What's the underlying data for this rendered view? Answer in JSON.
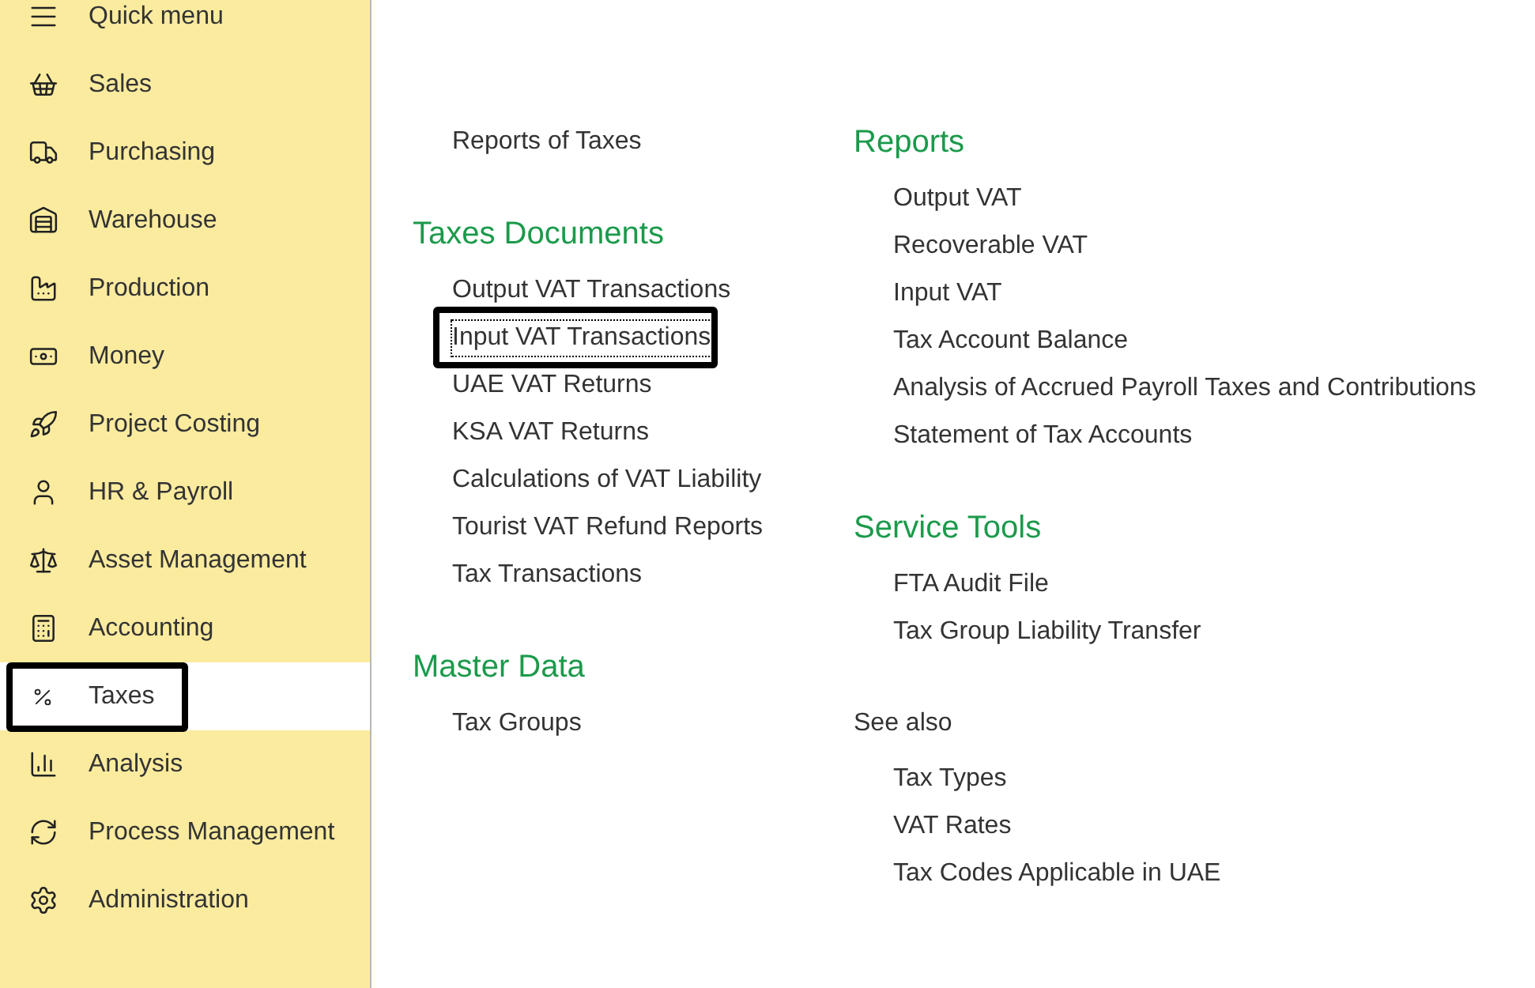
{
  "sidebar": {
    "items": [
      {
        "label": "Quick menu",
        "selected": false,
        "highlighted": false
      },
      {
        "label": "Sales",
        "selected": false,
        "highlighted": false
      },
      {
        "label": "Purchasing",
        "selected": false,
        "highlighted": false
      },
      {
        "label": "Warehouse",
        "selected": false,
        "highlighted": false
      },
      {
        "label": "Production",
        "selected": false,
        "highlighted": false
      },
      {
        "label": "Money",
        "selected": false,
        "highlighted": false
      },
      {
        "label": "Project Costing",
        "selected": false,
        "highlighted": false
      },
      {
        "label": "HR & Payroll",
        "selected": false,
        "highlighted": false
      },
      {
        "label": "Asset Management",
        "selected": false,
        "highlighted": false
      },
      {
        "label": "Accounting",
        "selected": false,
        "highlighted": false
      },
      {
        "label": "Taxes",
        "selected": true,
        "highlighted": true
      },
      {
        "label": "Analysis",
        "selected": false,
        "highlighted": false
      },
      {
        "label": "Process Management",
        "selected": false,
        "highlighted": false
      },
      {
        "label": "Administration",
        "selected": false,
        "highlighted": false
      }
    ]
  },
  "columns": [
    {
      "sections": [
        {
          "links": [
            {
              "label": "Reports of Taxes",
              "highlighted": false
            }
          ]
        },
        {
          "heading": "Taxes Documents",
          "kind": "group",
          "links": [
            {
              "label": "Output VAT Transactions",
              "highlighted": false
            },
            {
              "label": "Input VAT Transactions",
              "highlighted": true
            },
            {
              "label": "UAE VAT Returns",
              "highlighted": false
            },
            {
              "label": "KSA VAT Returns",
              "highlighted": false
            },
            {
              "label": "Calculations of VAT Liability",
              "highlighted": false
            },
            {
              "label": "Tourist VAT Refund Reports",
              "highlighted": false
            },
            {
              "label": "Tax Transactions",
              "highlighted": false
            }
          ]
        },
        {
          "heading": "Master Data",
          "kind": "group",
          "links": [
            {
              "label": "Tax Groups",
              "highlighted": false
            }
          ]
        }
      ]
    },
    {
      "sections": [
        {
          "heading": "Reports",
          "kind": "group",
          "links": [
            {
              "label": "Output VAT",
              "highlighted": false
            },
            {
              "label": "Recoverable VAT",
              "highlighted": false
            },
            {
              "label": "Input VAT",
              "highlighted": false
            },
            {
              "label": "Tax Account Balance",
              "highlighted": false
            },
            {
              "label": "Analysis of Accrued Payroll Taxes and Contributions",
              "highlighted": false
            },
            {
              "label": "Statement of Tax Accounts",
              "highlighted": false
            }
          ]
        },
        {
          "heading": "Service Tools",
          "kind": "group",
          "links": [
            {
              "label": "FTA Audit File",
              "highlighted": false
            },
            {
              "label": "Tax Group Liability Transfer",
              "highlighted": false
            }
          ]
        },
        {
          "heading": "See also",
          "kind": "see_also",
          "links": [
            {
              "label": "Tax Types",
              "highlighted": false
            },
            {
              "label": "VAT Rates",
              "highlighted": false
            },
            {
              "label": "Tax Codes Applicable in UAE",
              "highlighted": false
            }
          ]
        }
      ]
    }
  ]
}
